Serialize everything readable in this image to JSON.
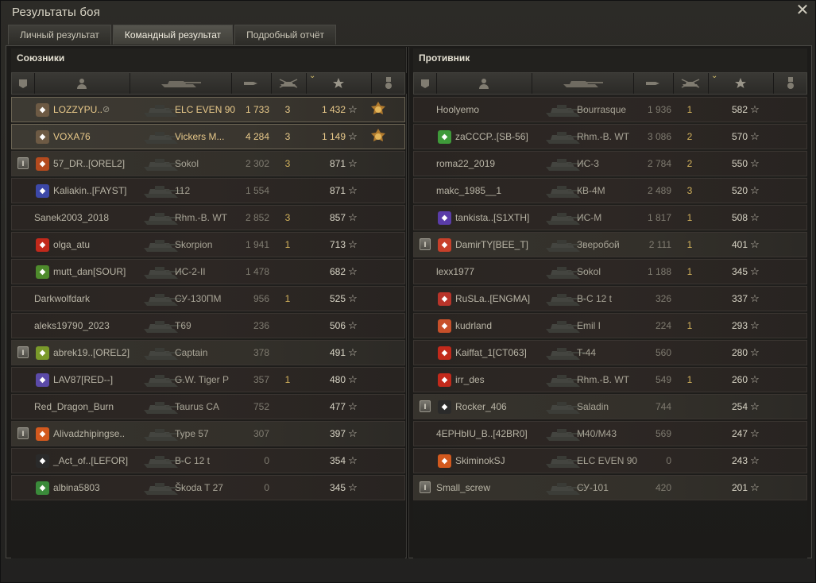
{
  "window": {
    "title": "Результаты боя",
    "close_icon": "close-icon"
  },
  "tabs": [
    {
      "label": "Личный результат",
      "active": false
    },
    {
      "label": "Командный результат",
      "active": true
    },
    {
      "label": "Подробный отчёт",
      "active": false
    }
  ],
  "allies": {
    "title": "Союзники",
    "rows": [
      {
        "name": "LOZZYPU..",
        "tank": "ELC EVEN 90",
        "damage": "1 733",
        "kills": "3",
        "xp": "1 432",
        "me": true,
        "clan": true,
        "clan_color": "#6d5a44",
        "medal": true,
        "muted": true
      },
      {
        "name": "VOXA76",
        "tank": "Vickers M...",
        "damage": "4 284",
        "kills": "3",
        "xp": "1 149",
        "me": true,
        "clan": true,
        "clan_color": "#6d5a44",
        "medal": true
      },
      {
        "name": "57_DR..[OREL2]",
        "tank": "Sokol",
        "damage": "2 302",
        "kills": "3",
        "xp": "871",
        "platoon": true,
        "clan": true,
        "clan_color": "#b34a1e"
      },
      {
        "name": "Kaliakin..[FAYST]",
        "tank": "112",
        "damage": "1 554",
        "kills": "",
        "xp": "871",
        "clan": true,
        "clan_color": "#3c48a8"
      },
      {
        "name": "Sanek2003_2018",
        "tank": "Rhm.-B. WT",
        "damage": "2 852",
        "kills": "3",
        "xp": "857"
      },
      {
        "name": "olga_atu",
        "tank": "Skorpion",
        "damage": "1 941",
        "kills": "1",
        "xp": "713",
        "clan": true,
        "clan_color": "#c2291b"
      },
      {
        "name": "mutt_dan[SOUR]",
        "tank": "ИС-2-II",
        "damage": "1 478",
        "kills": "",
        "xp": "682",
        "clan": true,
        "clan_color": "#4e8a2c"
      },
      {
        "name": "Darkwolfdark",
        "tank": "СУ-130ПМ",
        "damage": "956",
        "kills": "1",
        "xp": "525"
      },
      {
        "name": "aleks19790_2023",
        "tank": "T69",
        "damage": "236",
        "kills": "",
        "xp": "506"
      },
      {
        "name": "abrek19..[OREL2]",
        "tank": "Captain",
        "damage": "378",
        "kills": "",
        "xp": "491",
        "platoon": true,
        "clan": true,
        "clan_color": "#7a9a2a"
      },
      {
        "name": "LAV87[RED--]",
        "tank": "G.W. Tiger P",
        "damage": "357",
        "kills": "1",
        "xp": "480",
        "clan": true,
        "clan_color": "#5b4aa8"
      },
      {
        "name": "Red_Dragon_Burn",
        "tank": "Taurus CA",
        "damage": "752",
        "kills": "",
        "xp": "477"
      },
      {
        "name": "Alivadzhipingse..",
        "tank": "Type 57",
        "damage": "307",
        "kills": "",
        "xp": "397",
        "platoon": true,
        "clan": true,
        "clan_color": "#d2591e"
      },
      {
        "name": "_Act_of..[LEFOR]",
        "tank": "B-C 12 t",
        "damage": "0",
        "kills": "",
        "xp": "354",
        "clan": true,
        "clan_color": "#2a2a2a"
      },
      {
        "name": "albina5803",
        "tank": "Škoda T 27",
        "damage": "0",
        "kills": "",
        "xp": "345",
        "clan": true,
        "clan_color": "#3a8a3a"
      }
    ]
  },
  "enemies": {
    "title": "Противник",
    "rows": [
      {
        "name": "Hoolyemo",
        "tank": "Bourrasque",
        "damage": "1 936",
        "kills": "1",
        "xp": "582"
      },
      {
        "name": "zaCCCP..[SB-56]",
        "tank": "Rhm.-B. WT",
        "damage": "3 086",
        "kills": "2",
        "xp": "570",
        "clan": true,
        "clan_color": "#3f9a3a"
      },
      {
        "name": "roma22_2019",
        "tank": "ИС-3",
        "damage": "2 784",
        "kills": "2",
        "xp": "550"
      },
      {
        "name": "makc_1985__1",
        "tank": "КВ-4М",
        "damage": "2 489",
        "kills": "3",
        "xp": "520"
      },
      {
        "name": "tankista..[S1XTH]",
        "tank": "ИС-М",
        "damage": "1 817",
        "kills": "1",
        "xp": "508",
        "clan": true,
        "clan_color": "#5a3ca8"
      },
      {
        "name": "DamirTY[BEE_T]",
        "tank": "Зверобой",
        "damage": "2 111",
        "kills": "1",
        "xp": "401",
        "platoon": true,
        "clan": true,
        "clan_color": "#c8402a"
      },
      {
        "name": "lexx1977",
        "tank": "Sokol",
        "damage": "1 188",
        "kills": "1",
        "xp": "345"
      },
      {
        "name": "RuSLa..[ENGMA]",
        "tank": "B-C 12 t",
        "damage": "326",
        "kills": "",
        "xp": "337",
        "clan": true,
        "clan_color": "#b8342a"
      },
      {
        "name": "kudrland",
        "tank": "Emil I",
        "damage": "224",
        "kills": "1",
        "xp": "293",
        "clan": true,
        "clan_color": "#c8502a"
      },
      {
        "name": "Kaiffat_1[CT063]",
        "tank": "T-44",
        "damage": "560",
        "kills": "",
        "xp": "280",
        "clan": true,
        "clan_color": "#c2291b"
      },
      {
        "name": "irr_des",
        "tank": "Rhm.-B. WT",
        "damage": "549",
        "kills": "1",
        "xp": "260",
        "clan": true,
        "clan_color": "#c2291b"
      },
      {
        "name": "Rocker_406",
        "tank": "Saladin",
        "damage": "744",
        "kills": "",
        "xp": "254",
        "platoon": true,
        "clan": true,
        "clan_color": "#2a2a2a"
      },
      {
        "name": "4EPHbIU_B..[42BR0]",
        "tank": "M40/M43",
        "damage": "569",
        "kills": "",
        "xp": "247"
      },
      {
        "name": "SkiminokSJ",
        "tank": "ELC EVEN 90",
        "damage": "0",
        "kills": "",
        "xp": "243",
        "clan": true,
        "clan_color": "#d2591e"
      },
      {
        "name": "Small_screw",
        "tank": "СУ-101",
        "damage": "420",
        "kills": "",
        "xp": "201",
        "platoon": true
      }
    ]
  },
  "columns": [
    {
      "icon": "squad-icon"
    },
    {
      "icon": "player-icon"
    },
    {
      "icon": "tank-icon"
    },
    {
      "icon": "damage-icon"
    },
    {
      "icon": "kills-icon"
    },
    {
      "icon": "experience-star-icon",
      "sorted": true
    },
    {
      "icon": "medal-icon"
    }
  ]
}
